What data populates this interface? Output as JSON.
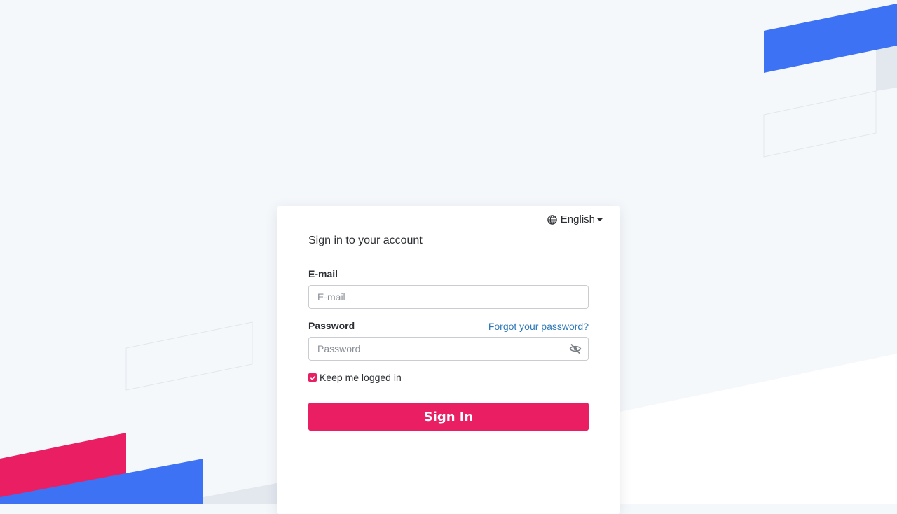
{
  "language": {
    "icon": "globe-icon",
    "selected": "English"
  },
  "form": {
    "title": "Sign in to your account",
    "email_label": "E-mail",
    "email_placeholder": "E-mail",
    "email_value": "",
    "password_label": "Password",
    "password_placeholder": "Password",
    "password_value": "",
    "password_toggle_icon": "eye-slash-icon",
    "forgot_link": "Forgot your password?",
    "keep_logged_in_label": "Keep me logged in",
    "keep_logged_in_checked": true,
    "submit_label": "Sign In"
  },
  "colors": {
    "accent_pink": "#e91e63",
    "accent_blue": "#3d72f5",
    "link_blue": "#2f79b9",
    "background": "#f5f8fb"
  }
}
